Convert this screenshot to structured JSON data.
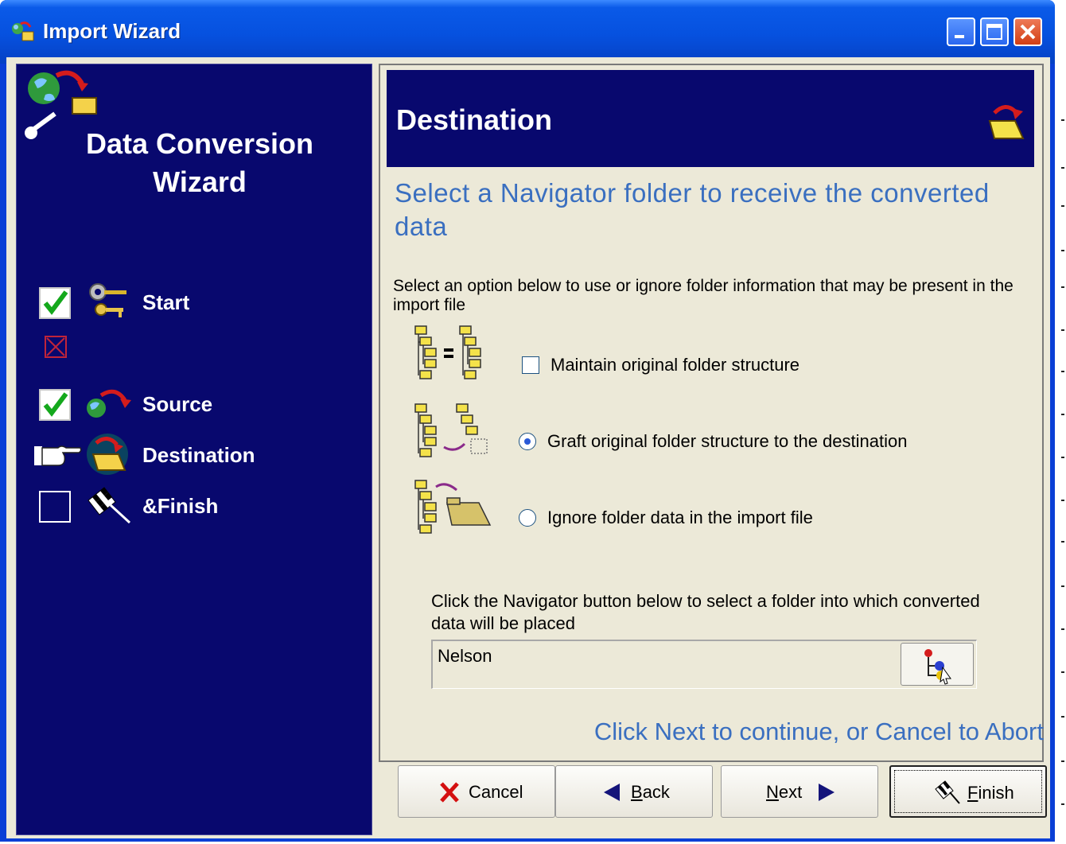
{
  "window": {
    "title": "Import Wizard",
    "controls": [
      "minimize",
      "maximize",
      "close"
    ]
  },
  "sidebar": {
    "title_line1": "Data Conversion",
    "title_line2": "Wizard",
    "steps": [
      {
        "label": "Start",
        "status": "checked",
        "icon": "keys-icon"
      },
      {
        "label": "",
        "status": "error",
        "icon": ""
      },
      {
        "label": "Source",
        "status": "checked",
        "icon": "globe-arrow-icon"
      },
      {
        "label": "Destination",
        "status": "current",
        "icon": "folder-arrow-icon"
      },
      {
        "label": "&Finish",
        "status": "unchecked",
        "icon": "checkered-flag-icon"
      }
    ]
  },
  "header": {
    "title": "Destination"
  },
  "content": {
    "subtitle": "Select a Navigator folder to receive the converted data",
    "option_intro": "Select an option below to use or ignore folder information that may be present in the import file",
    "options": [
      {
        "label": "Maintain original folder structure",
        "control": "checkbox",
        "checked": false
      },
      {
        "label": "Graft original folder structure to the destination",
        "control": "radio",
        "checked": true
      },
      {
        "label": "Ignore folder data in the import file",
        "control": "radio",
        "checked": false
      }
    ],
    "navigator_instruction": "Click the Navigator button below to select a folder into which converted data will be placed",
    "folder_value": "Nelson",
    "continue_hint": "Click Next to continue, or Cancel to Abort"
  },
  "buttons": {
    "cancel": "Cancel",
    "back_accel": "B",
    "back_rest": "ack",
    "next_accel": "N",
    "next_rest": "ext",
    "finish_accel": "F",
    "finish_rest": "inish"
  },
  "colors": {
    "panel_navy": "#08086e",
    "accent_blue_text": "#3a6fc0",
    "title_bar_blue": "#0651df",
    "dialog_bg": "#ece9d8"
  }
}
